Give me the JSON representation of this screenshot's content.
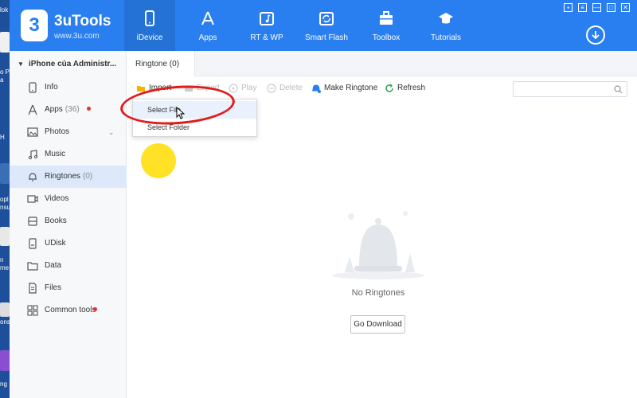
{
  "desktop": {
    "fragments": [
      "lok",
      "o P",
      "a",
      "H",
      "opl",
      "nsu",
      "n",
      "me",
      "ons",
      "ng"
    ]
  },
  "app": {
    "brand_name": "3uTools",
    "brand_url": "www.3u.com",
    "logo_glyph": "3",
    "accent_color": "#2a7ff0",
    "nav": [
      {
        "label": "iDevice",
        "icon": "phone-icon",
        "active": true
      },
      {
        "label": "Apps",
        "icon": "app-store-icon",
        "active": false
      },
      {
        "label": "RT & WP",
        "icon": "music-note-icon",
        "active": false
      },
      {
        "label": "Smart Flash",
        "icon": "refresh-box-icon",
        "active": false
      },
      {
        "label": "Toolbox",
        "icon": "toolbox-icon",
        "active": false
      },
      {
        "label": "Tutorials",
        "icon": "graduation-cap-icon",
        "active": false
      }
    ],
    "window_controls": [
      "▪",
      "≡",
      "—",
      "□",
      "✕"
    ]
  },
  "sidebar": {
    "device_name": "iPhone của Administr...",
    "items": [
      {
        "label": "Info",
        "count": "",
        "icon": "info-phone-icon",
        "dot": false,
        "active": false
      },
      {
        "label": "Apps",
        "count": "(36)",
        "icon": "apps-icon",
        "dot": true,
        "active": false
      },
      {
        "label": "Photos",
        "count": "",
        "icon": "photo-icon",
        "dot": false,
        "active": false,
        "chevron": "⌄"
      },
      {
        "label": "Music",
        "count": "",
        "icon": "music-icon",
        "dot": false,
        "active": false
      },
      {
        "label": "Ringtones",
        "count": "(0)",
        "icon": "bell-icon",
        "dot": false,
        "active": true
      },
      {
        "label": "Videos",
        "count": "",
        "icon": "video-icon",
        "dot": false,
        "active": false
      },
      {
        "label": "Books",
        "count": "",
        "icon": "book-icon",
        "dot": false,
        "active": false
      },
      {
        "label": "UDisk",
        "count": "",
        "icon": "udisk-icon",
        "dot": false,
        "active": false
      },
      {
        "label": "Data",
        "count": "",
        "icon": "folder-icon",
        "dot": false,
        "active": false
      },
      {
        "label": "Files",
        "count": "",
        "icon": "file-icon",
        "dot": false,
        "active": false
      },
      {
        "label": "Common tools",
        "count": "",
        "icon": "grid-icon",
        "dot": true,
        "active": false
      }
    ]
  },
  "main": {
    "tab_label": "Ringtone (0)",
    "toolbar": {
      "import": "Import",
      "export": "Export",
      "play": "Play",
      "delete": "Delete",
      "make_ringtone": "Make Ringtone",
      "refresh": "Refresh"
    },
    "search_placeholder": "",
    "dropdown": {
      "select_file": "Select File",
      "select_folder": "Select Folder"
    },
    "empty_text": "No Ringtones",
    "go_download": "Go Download"
  }
}
